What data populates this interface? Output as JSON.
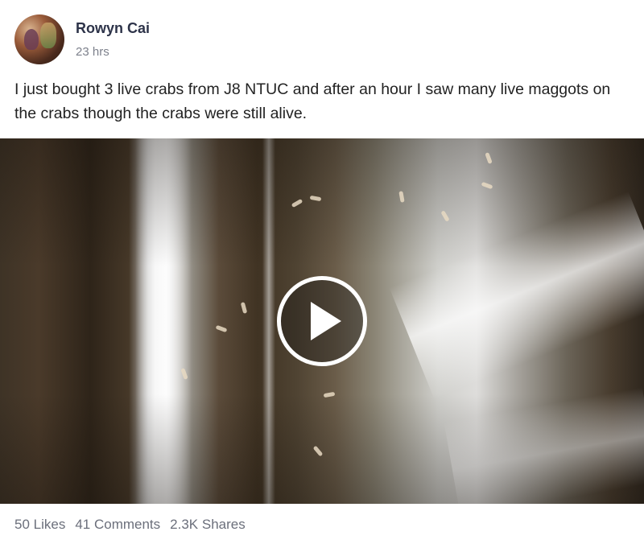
{
  "post": {
    "author": "Rowyn Cai",
    "time": "23 hrs",
    "text": "I just bought 3 live crabs from J8 NTUC and after an hour I saw many live maggots on the crabs though the crabs were still alive."
  },
  "video": {
    "play_icon": "play-icon"
  },
  "stats": {
    "likes": "50 Likes",
    "comments": "41 Comments",
    "shares": "2.3K Shares"
  },
  "colors": {
    "author": "#2d3349",
    "muted": "#7d818c",
    "text": "#222222"
  }
}
